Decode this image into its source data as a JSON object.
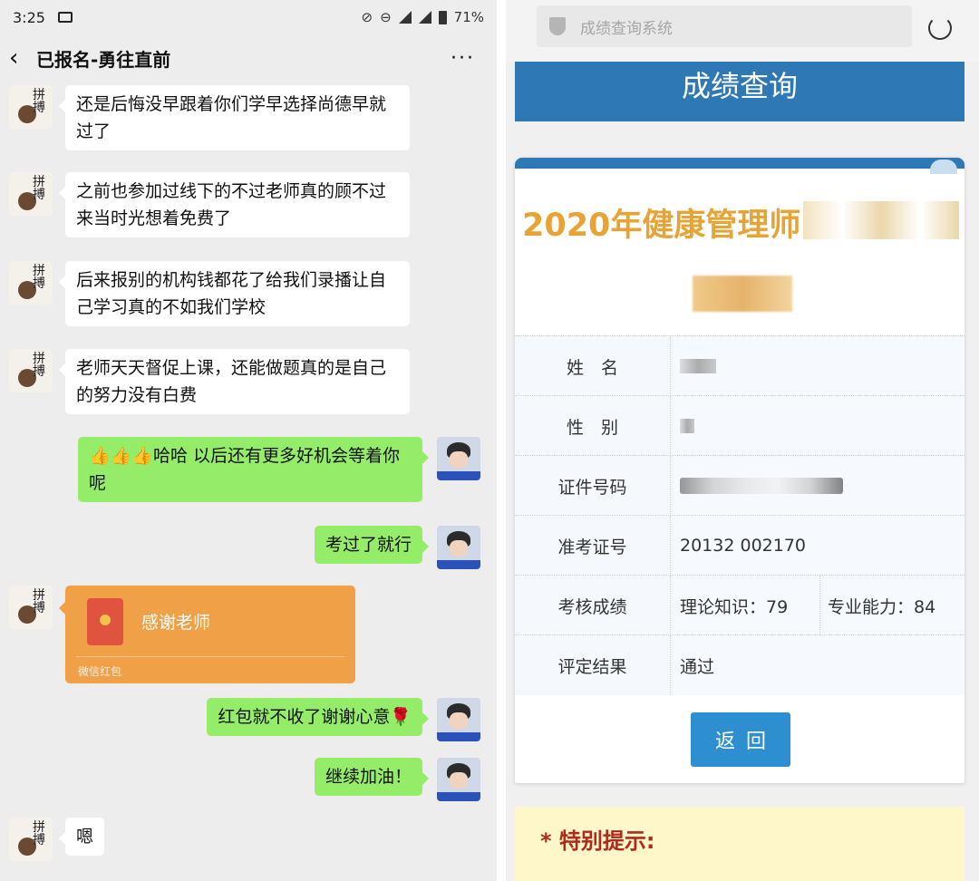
{
  "status_bar": {
    "time": "3:25",
    "battery": "71%"
  },
  "chat": {
    "title": "已报名-勇往直前",
    "back_icon": "‹",
    "more_icon": "···",
    "messages": [
      {
        "from": "teacher",
        "text": "还是后悔没早跟着你们学早选择尚德早就过了"
      },
      {
        "from": "teacher",
        "text": "之前也参加过线下的不过老师真的顾不过来当时光想着免费了"
      },
      {
        "from": "teacher",
        "text": "后来报别的机构钱都花了给我们录播让自己学习真的不如我们学校"
      },
      {
        "from": "teacher",
        "text": "老师天天督促上课，还能做题真的是自己的努力没有白费"
      },
      {
        "from": "student",
        "text": "👍👍👍哈哈 以后还有更多好机会等着你呢"
      },
      {
        "from": "student",
        "text": "考过了就行"
      },
      {
        "from": "teacher",
        "type": "red_packet",
        "text": "感谢老师",
        "footer": "微信红包"
      },
      {
        "from": "student",
        "text": "红包就不收了谢谢心意🌹"
      },
      {
        "from": "student",
        "text": "继续加油！"
      },
      {
        "from": "teacher",
        "text": "嗯"
      }
    ],
    "teacher_avatar_text": "拼搏"
  },
  "browser": {
    "url_text": "成绩查询系统"
  },
  "score_page": {
    "banner": "成绩查询",
    "exam_title": "2020年健康管理师",
    "rows": [
      {
        "label": "姓　名",
        "value": ""
      },
      {
        "label": "性　别",
        "value": ""
      },
      {
        "label": "证件号码",
        "value": ""
      },
      {
        "label": "准考证号",
        "value": "20132 002170"
      },
      {
        "label": "考核成绩",
        "value": "理论知识：79",
        "value2": "专业能力：84"
      },
      {
        "label": "评定结果",
        "value": "通过"
      }
    ],
    "button": "返回",
    "notice": "* 特别提示:"
  },
  "colors": {
    "wechat_green": "#95ec69",
    "banner_blue": "#2e78b5",
    "title_orange": "#e7a334",
    "red_packet": "#f0a046"
  }
}
